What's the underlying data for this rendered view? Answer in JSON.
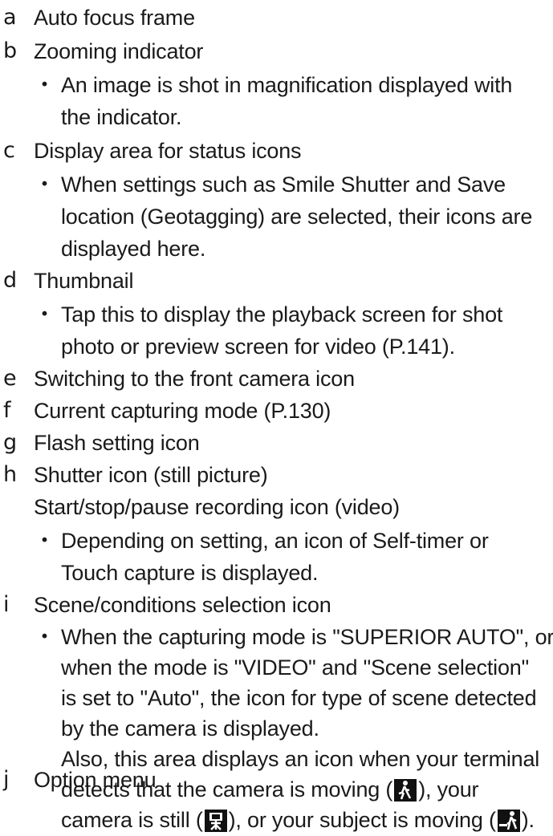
{
  "items": [
    {
      "letter": "a",
      "lines": [
        "Auto focus frame"
      ]
    },
    {
      "letter": "b",
      "lines": [
        "Zooming indicator"
      ],
      "bullet_lines": [
        "An image is shot in magnification displayed with",
        "the indicator."
      ]
    },
    {
      "letter": "c",
      "lines": [
        "Display area for status icons"
      ],
      "bullet_lines": [
        "When settings such as Smile Shutter and Save",
        "location (Geotagging) are selected, their icons are",
        "displayed here."
      ]
    },
    {
      "letter": "d",
      "lines": [
        "Thumbnail"
      ],
      "bullet_lines": [
        "Tap this to display the playback screen for shot",
        "photo or preview screen for video (P.141)."
      ]
    },
    {
      "letter": "e",
      "lines": [
        "Switching to the front camera icon"
      ]
    },
    {
      "letter": "f",
      "lines": [
        "Current capturing mode (P.130)"
      ]
    },
    {
      "letter": "g",
      "lines": [
        "Flash setting icon"
      ]
    },
    {
      "letter": "h",
      "lines": [
        "Shutter icon (still picture)",
        "Start/stop/pause recording icon (video)"
      ],
      "bullet_lines": [
        "Depending on setting, an icon of Self-timer or",
        "Touch capture is displayed."
      ]
    },
    {
      "letter": "i",
      "lines": [
        "Scene/conditions selection icon"
      ],
      "bullet_lines": [
        "When the capturing mode is \"SUPERIOR AUTO\", or",
        "when the mode is \"VIDEO\" and \"Scene selection\"",
        "is set to \"Auto\", the icon for type of scene detected",
        "by the camera is displayed.",
        "Also, this area displays an icon when your terminal"
      ],
      "icon_lines": {
        "line1_pre": "detects that the camera is moving (",
        "line1_post": "), your",
        "line2_pre": "camera is still (",
        "line2_mid": "), or your subject is moving (",
        "line2_post": ")."
      }
    },
    {
      "letter": "j",
      "lines": [
        "Option menu"
      ]
    }
  ],
  "bullet_symbol": "・",
  "icons": [
    "camera-moving-icon",
    "camera-still-icon",
    "subject-moving-icon"
  ]
}
